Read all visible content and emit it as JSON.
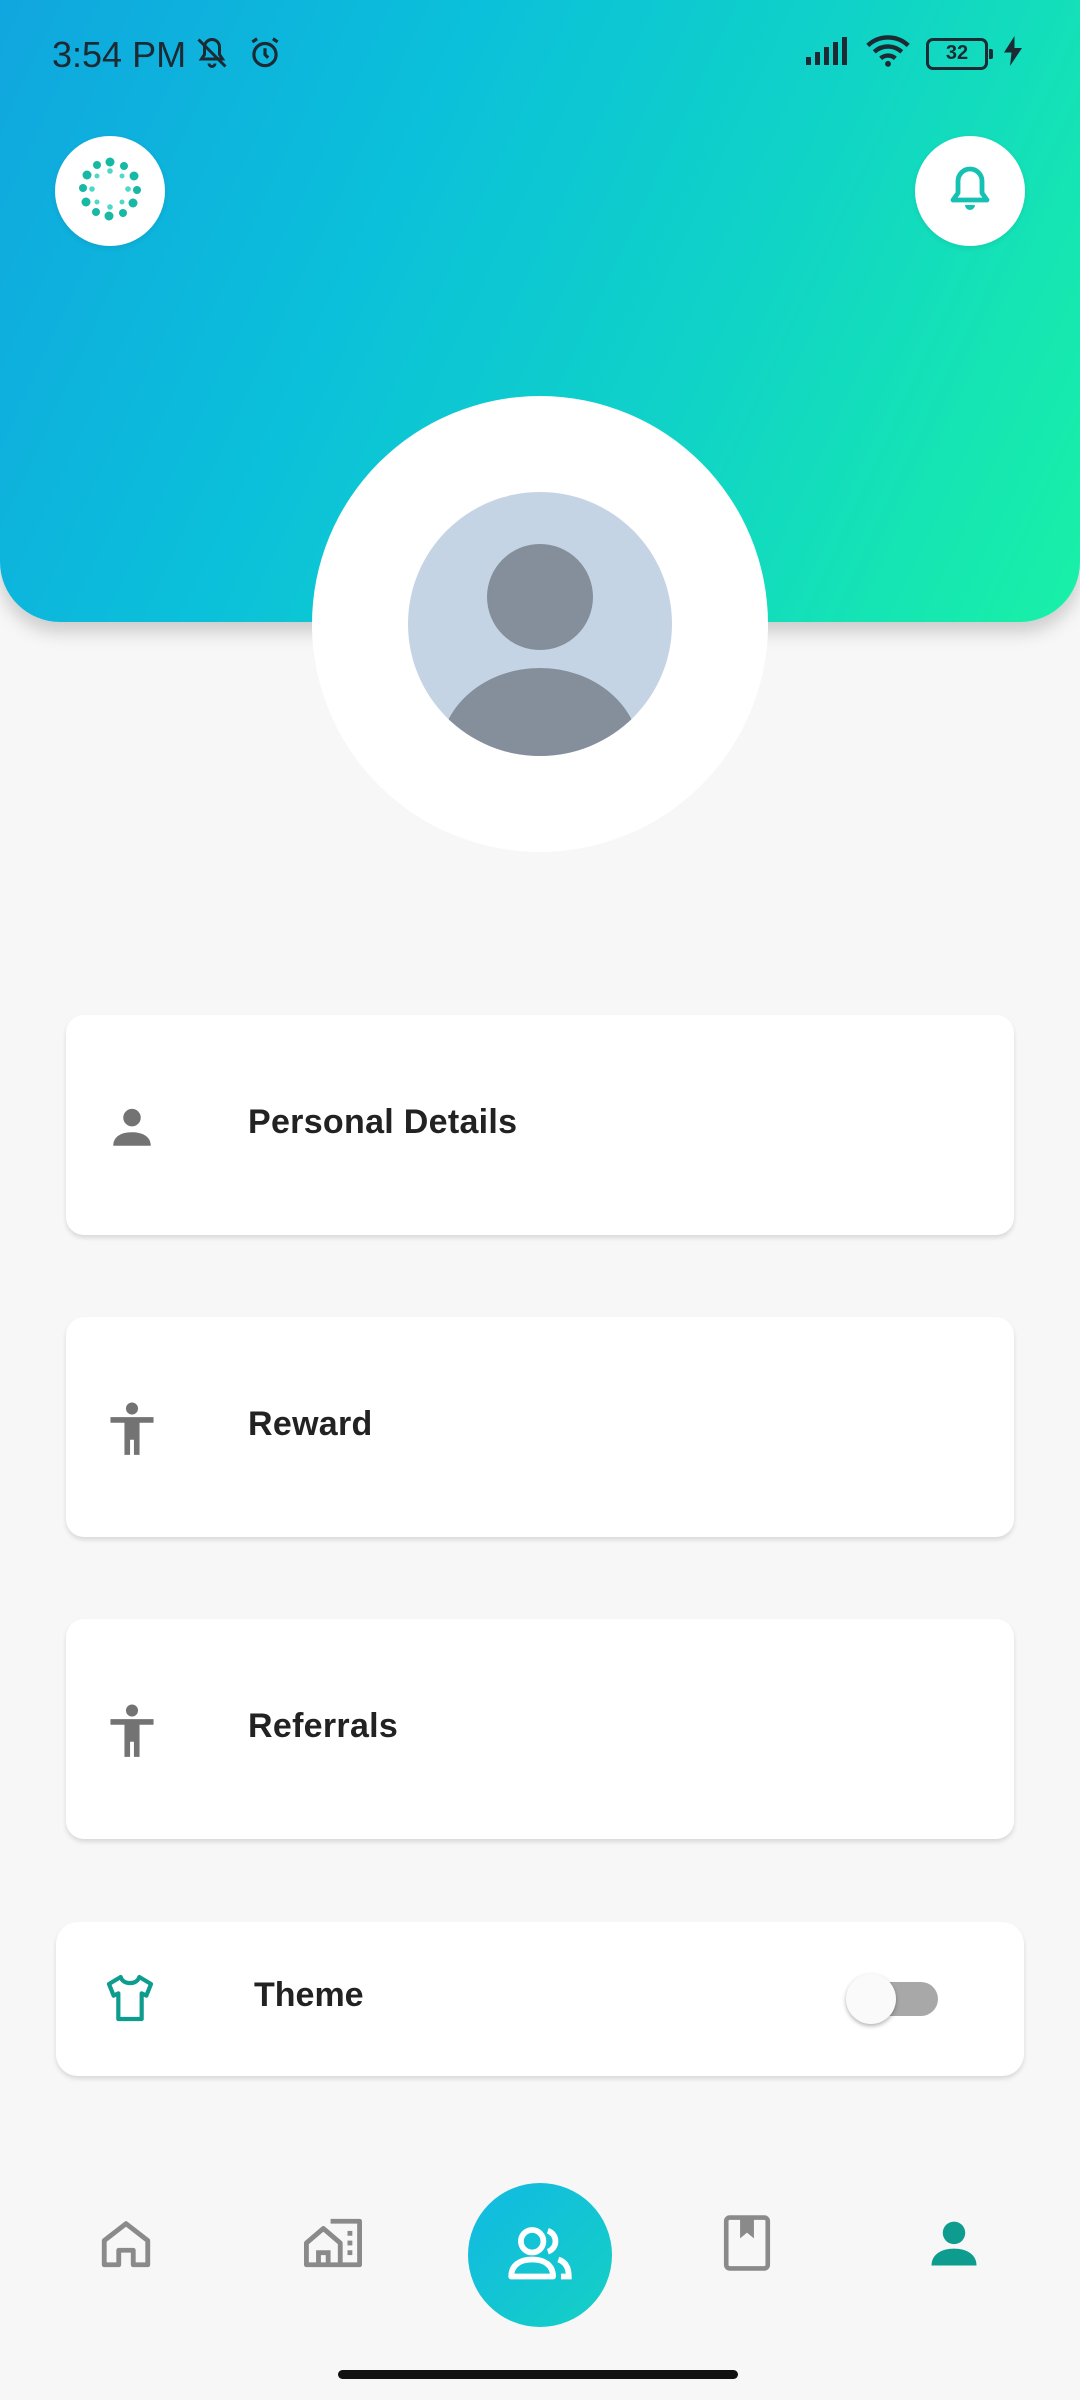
{
  "status_bar": {
    "time": "3:54 PM",
    "battery_level": "32"
  },
  "header": {
    "icons": [
      "app-logo-icon",
      "bell-icon"
    ]
  },
  "menu": {
    "items": [
      {
        "label": "Personal Details",
        "icon": "person-icon"
      },
      {
        "label": "Reward",
        "icon": "accessibility-icon"
      },
      {
        "label": "Referrals",
        "icon": "accessibility-icon"
      }
    ],
    "theme": {
      "label": "Theme",
      "icon": "shirt-icon",
      "enabled": false
    }
  },
  "bottom_nav": {
    "items": [
      "home-icon",
      "buildings-icon",
      "people-icon",
      "book-icon",
      "profile-icon"
    ],
    "active": "profile-icon"
  },
  "colors": {
    "accent": "#0e9c8e",
    "gradient_start": "#10a6df",
    "gradient_end": "#19f1a6",
    "icon_grey": "#737373"
  }
}
